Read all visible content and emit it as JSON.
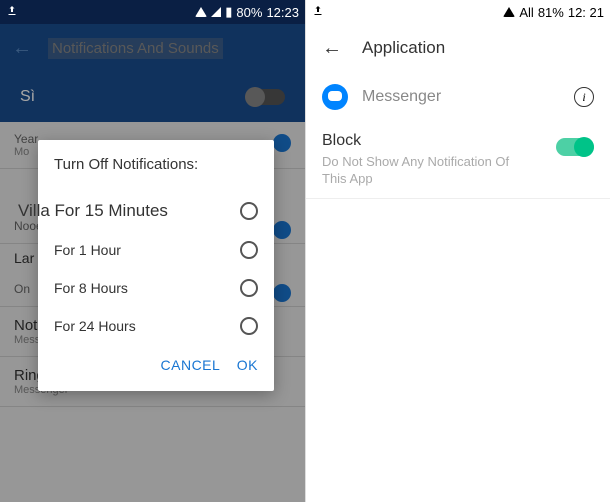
{
  "left": {
    "status": {
      "battery": "80%",
      "time": "12:23"
    },
    "header_title": "Notifications And Sounds",
    "si_label": "Sì",
    "dialog": {
      "title": "Turn Off Notifications:",
      "options": [
        "Villa For 15 Minutes",
        "For 1 Hour",
        "For 8 Hours",
        "For 24 Hours"
      ],
      "cancel": "CANCEL",
      "ok": "OK"
    },
    "bg_rows": {
      "year_label": "Year",
      "year_sub": "Mo",
      "nooe": "Nooe",
      "lar": "Lar",
      "on": "On",
      "notif_sound": "Notification Sound",
      "notif_sound_sub": "Messenger",
      "ringtone": "Ringtone For Free Calls",
      "ringtone_sub": "Messenger"
    }
  },
  "right": {
    "status": {
      "network": "All",
      "battery": "81%",
      "time": "12: 21"
    },
    "header_title": "Application",
    "app_name": "Messenger",
    "block": {
      "title": "Block",
      "desc": "Do Not Show Any Notification Of This App"
    }
  }
}
